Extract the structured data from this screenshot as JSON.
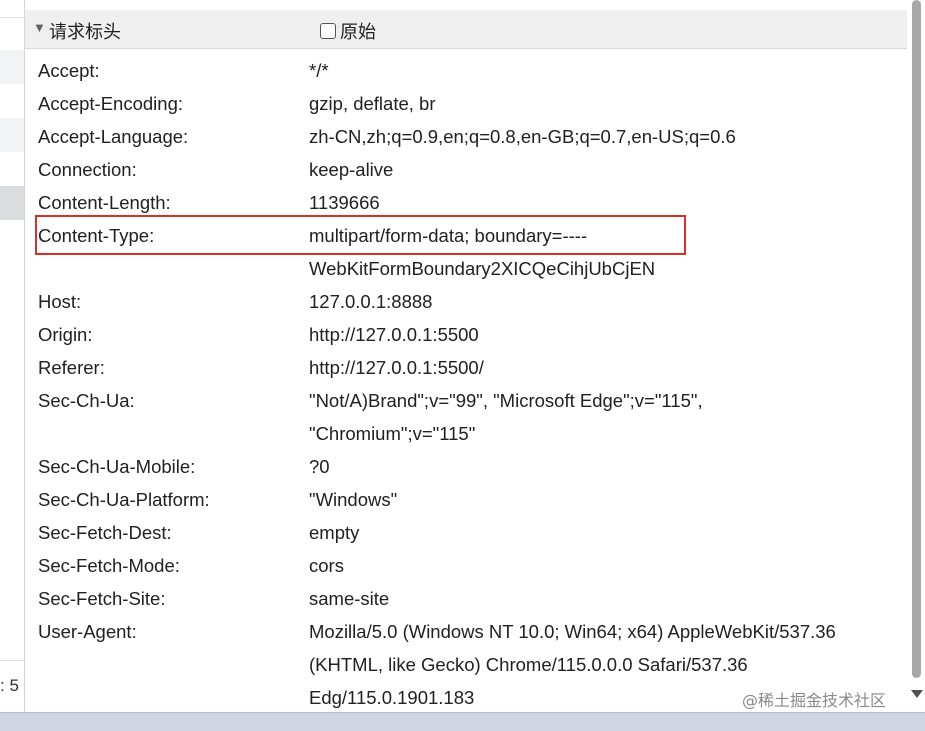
{
  "section": {
    "toggle_icon": "▼",
    "title": "请求标头",
    "raw_label": "原始",
    "raw_checked": false
  },
  "left_panel": {
    "cut_text": ": 5"
  },
  "headers": [
    {
      "name": "Accept:",
      "lines": [
        "*/*"
      ]
    },
    {
      "name": "Accept-Encoding:",
      "lines": [
        "gzip, deflate, br"
      ]
    },
    {
      "name": "Accept-Language:",
      "lines": [
        "zh-CN,zh;q=0.9,en;q=0.8,en-GB;q=0.7,en-US;q=0.6"
      ]
    },
    {
      "name": "Connection:",
      "lines": [
        "keep-alive"
      ]
    },
    {
      "name": "Content-Length:",
      "lines": [
        "1139666"
      ]
    },
    {
      "name": "Content-Type:",
      "lines": [
        "multipart/form-data; boundary=----",
        "WebKitFormBoundary2XICQeCihjUbCjEN"
      ],
      "highlighted": true
    },
    {
      "name": "Host:",
      "lines": [
        "127.0.0.1:8888"
      ]
    },
    {
      "name": "Origin:",
      "lines": [
        "http://127.0.0.1:5500"
      ]
    },
    {
      "name": "Referer:",
      "lines": [
        "http://127.0.0.1:5500/"
      ]
    },
    {
      "name": "Sec-Ch-Ua:",
      "lines": [
        "\"Not/A)Brand\";v=\"99\", \"Microsoft Edge\";v=\"115\",",
        "\"Chromium\";v=\"115\""
      ]
    },
    {
      "name": "Sec-Ch-Ua-Mobile:",
      "lines": [
        "?0"
      ]
    },
    {
      "name": "Sec-Ch-Ua-Platform:",
      "lines": [
        "\"Windows\""
      ]
    },
    {
      "name": "Sec-Fetch-Dest:",
      "lines": [
        "empty"
      ]
    },
    {
      "name": "Sec-Fetch-Mode:",
      "lines": [
        "cors"
      ]
    },
    {
      "name": "Sec-Fetch-Site:",
      "lines": [
        "same-site"
      ]
    },
    {
      "name": "User-Agent:",
      "lines": [
        "Mozilla/5.0 (Windows NT 10.0; Win64; x64) AppleWebKit/537.36",
        "(KHTML, like Gecko) Chrome/115.0.0.0 Safari/537.36",
        "Edg/115.0.1901.183"
      ]
    }
  ],
  "watermark": "@稀土掘金技术社区",
  "colors": {
    "highlight_border": "#d93025",
    "header_bg": "#efefef",
    "bottom_bar": "#cfd6e2"
  }
}
